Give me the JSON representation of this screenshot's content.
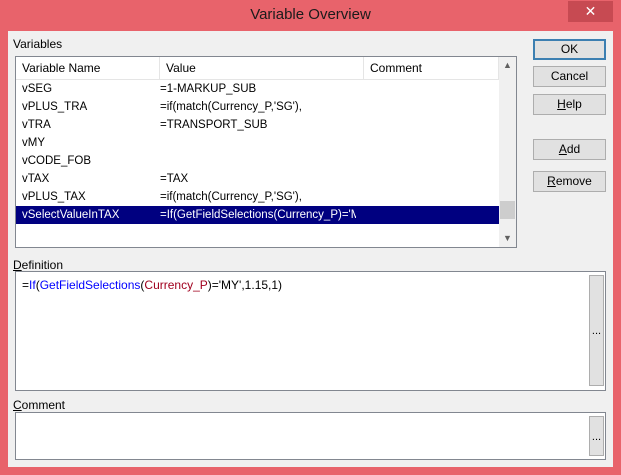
{
  "window": {
    "title": "Variable Overview",
    "close_glyph": "✕"
  },
  "variables": {
    "group_label": "Variables",
    "columns": [
      "Variable Name",
      "Value",
      "Comment"
    ],
    "rows": [
      {
        "name": "vSEG",
        "value": "=1-MARKUP_SUB",
        "comment": ""
      },
      {
        "name": "vPLUS_TRA",
        "value": "=if(match(Currency_P,'SG'),",
        "comment": ""
      },
      {
        "name": "vTRA",
        "value": "=TRANSPORT_SUB",
        "comment": ""
      },
      {
        "name": "vMY",
        "value": "",
        "comment": ""
      },
      {
        "name": "vCODE_FOB",
        "value": "",
        "comment": ""
      },
      {
        "name": "vTAX",
        "value": "=TAX",
        "comment": ""
      },
      {
        "name": "vPLUS_TAX",
        "value": "=if(match(Currency_P,'SG'),",
        "comment": ""
      },
      {
        "name": "vSelectValueInTAX",
        "value": "=If(GetFieldSelections(Currency_P)='MY'",
        "comment": "",
        "selected": true
      }
    ]
  },
  "definition": {
    "label_underlined": "D",
    "label_rest": "efinition",
    "tokens": {
      "p1": "=",
      "f1": "If",
      "p2": "(",
      "f2": "GetFieldSelections",
      "p3": "(",
      "field": "Currency_P",
      "p4": ")='MY',1.15,1)"
    },
    "browse_label": "..."
  },
  "comment": {
    "label_underlined": "C",
    "label_rest": "omment",
    "value": "",
    "browse_label": "..."
  },
  "buttons": {
    "ok": "OK",
    "cancel": "Cancel",
    "help_u": "H",
    "help_rest": "elp",
    "add_u": "A",
    "add_rest": "dd",
    "remove_u": "R",
    "remove_rest": "emove"
  },
  "scroll": {
    "up_glyph": "▲",
    "down_glyph": "▼"
  },
  "colors": {
    "title_bar": "#e8636b",
    "selection": "#000080",
    "function_token": "#0000ff",
    "field_token": "#a0001e"
  },
  "icons": {
    "close": "close-icon",
    "scroll_up": "chevron-up-icon",
    "scroll_down": "chevron-down-icon"
  }
}
